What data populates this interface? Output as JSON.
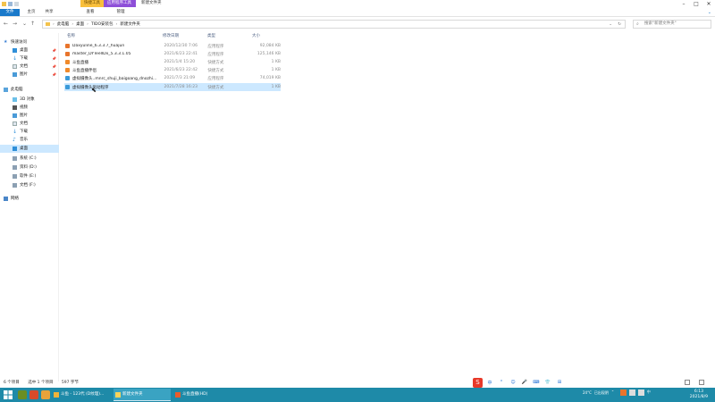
{
  "titlebar": {
    "context_tab_1": "快捷工具",
    "context_tab_2": "应用程序工具",
    "window_title": "新建文件夹",
    "icon_names": [
      "folder-icon",
      "save-icon",
      "undo-icon"
    ],
    "controls": [
      "minimize-icon",
      "maximize-icon",
      "close-icon"
    ]
  },
  "ribbon": {
    "tabs": [
      "文件",
      "主页",
      "共享",
      "查看",
      "管理"
    ],
    "help_icon": "chevron-down-icon"
  },
  "address_bar": {
    "segments": [
      "此电脑",
      "桌面",
      "TIDO安装包",
      "新建文件夹"
    ],
    "search_placeholder": "搜索\"新建文件夹\""
  },
  "sidebar": {
    "items": [
      {
        "label": "快速访问",
        "icon": "star-icon"
      },
      {
        "label": "桌面",
        "icon": "desktop-icon"
      },
      {
        "label": "下载",
        "icon": "download-icon"
      },
      {
        "label": "文档",
        "icon": "document-icon"
      },
      {
        "label": "图片",
        "icon": "picture-icon"
      },
      {
        "label": "此电脑",
        "icon": "computer-icon"
      },
      {
        "label": "3D 对象",
        "icon": "cube-icon"
      },
      {
        "label": "视频",
        "icon": "video-icon"
      },
      {
        "label": "图片",
        "icon": "picture-icon"
      },
      {
        "label": "文档",
        "icon": "document-icon"
      },
      {
        "label": "下载",
        "icon": "download-icon"
      },
      {
        "label": "音乐",
        "icon": "music-icon"
      },
      {
        "label": "桌面",
        "icon": "desktop-icon"
      },
      {
        "label": "系统 (C:)",
        "icon": "drive-icon"
      },
      {
        "label": "资料 (D:)",
        "icon": "drive-icon"
      },
      {
        "label": "软件 (E:)",
        "icon": "drive-icon"
      },
      {
        "label": "文档 (F:)",
        "icon": "drive-icon"
      },
      {
        "label": "网络",
        "icon": "network-icon"
      }
    ]
  },
  "columns": {
    "name": "名称",
    "date": "修改日期",
    "type": "类型",
    "size": "大小"
  },
  "files": [
    {
      "name": "Daxyuline_6.3.3.7_huajun",
      "date": "2020/12/30 7:06",
      "type": "应用程序",
      "size": "92,084 KB",
      "icon": "app-icon"
    },
    {
      "name": "master_DYTeelIDx_5.3.3.1.05",
      "date": "2021/6/23 22:41",
      "type": "应用程序",
      "size": "125,146 KB",
      "icon": "app-icon"
    },
    {
      "name": "斗鱼直播",
      "date": "2021/1/4 15:20",
      "type": "快捷方式",
      "size": "1 KB",
      "icon": "shortcut-icon"
    },
    {
      "name": "斗鱼直播伴侣",
      "date": "2021/6/23 22:42",
      "type": "快捷方式",
      "size": "1 KB",
      "icon": "shortcut-icon"
    },
    {
      "name": "虚拟摄像头..mnrc_shuji_baigoang_dnozhi...",
      "date": "2021/7/3 21:09",
      "type": "应用程序",
      "size": "74,019 KB",
      "icon": "installer-icon"
    },
    {
      "name": "虚拟摄像头驱动程序",
      "date": "2021/7/28 16:23",
      "type": "快捷方式",
      "size": "1 KB",
      "icon": "shortcut-icon"
    }
  ],
  "status_bar": {
    "item_count": "6 个项目",
    "selected": "选中 1 个项目",
    "selected_size": "597 字节"
  },
  "ime": {
    "logo": "S",
    "items": [
      "中",
      "°",
      "☺",
      "🎤",
      "⌨",
      "👕",
      "⊞"
    ]
  },
  "taskbar": {
    "tasks": [
      {
        "label": "斗鱼 - 123代 (D纹理)...",
        "color": "#f0b33a"
      },
      {
        "label": "新建文件夹",
        "color": "#f9d35b"
      },
      {
        "label": "斗鱼直播(HD)",
        "color": "#e85c2c"
      }
    ],
    "tray_weather": "24°C",
    "tray_weather_desc": "已出现阴",
    "time": "6:13",
    "date": "2021/8/9"
  }
}
